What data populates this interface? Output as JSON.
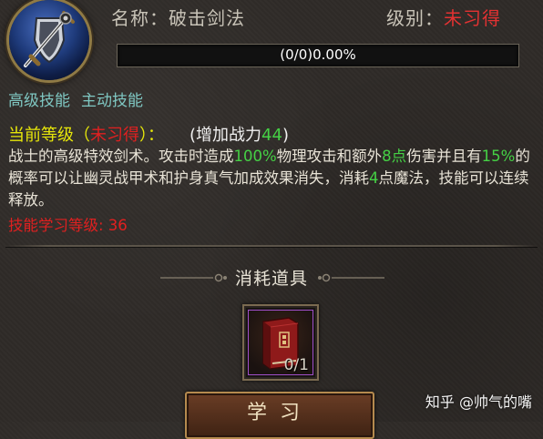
{
  "header": {
    "skill_icon": "sword-shield-icon",
    "name_label": "名称：",
    "name_value": "破击剑法",
    "level_label": "级别：",
    "level_value": "未习得"
  },
  "progress": {
    "text": "(0/0)0.00%",
    "fraction": 0.0
  },
  "tags": [
    "高级技能",
    "主动技能"
  ],
  "current": {
    "label": "当前等级",
    "open_paren": "（",
    "status": "未习得",
    "close_paren": "）：",
    "power_label": "(增加战力",
    "power_value": "44",
    "power_close": ")"
  },
  "description": {
    "part1": "战士的高级特效剑术。攻击时造成",
    "pct1": "100%",
    "part2": "物理攻击和额外",
    "pts": "8点",
    "part3": "伤害并且有",
    "pct2": "15%",
    "part4": "的概率可以让幽灵战甲术和护身真气加成效果消失，消耗",
    "mp": "4",
    "part5": "点魔法，技能可以连续释放。"
  },
  "learn_level": "技能学习等级: 36",
  "consumables": {
    "title": "消耗道具",
    "item_icon": "red-book-icon",
    "item_count": "0/1"
  },
  "learn_button_label": "学习",
  "watermark": "知乎 @帅气的嘴",
  "colors": {
    "accent_red": "#e02020",
    "accent_green": "#45d145",
    "accent_yellow": "#e6e60a",
    "accent_cyan": "#7fc7c2",
    "item_border_purple": "#a04fc9"
  }
}
